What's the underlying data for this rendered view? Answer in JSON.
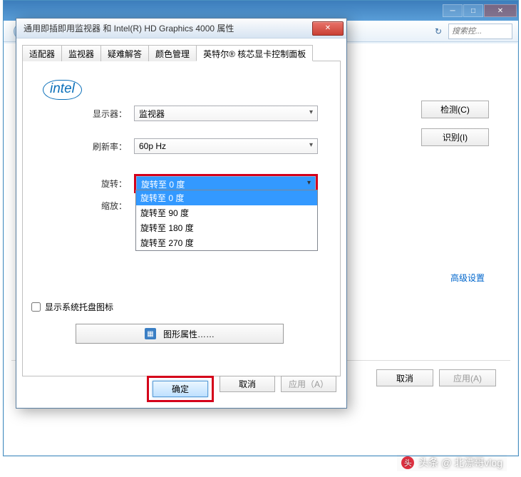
{
  "parent": {
    "search_placeholder": "搜索控...",
    "detect_btn": "检测(C)",
    "identify_btn": "识别(I)",
    "advanced": "高级设置",
    "cancel": "取消",
    "apply": "应用(A)"
  },
  "dialog": {
    "title": "通用即插即用监视器 和 Intel(R) HD Graphics 4000 属性",
    "tabs": {
      "adapter": "适配器",
      "monitor": "监视器",
      "troubleshoot": "疑难解答",
      "color": "颜色管理",
      "intel": "英特尔® 核芯显卡控制面板"
    },
    "logo": "intel",
    "labels": {
      "display": "显示器：",
      "refresh": "刷新率：",
      "rotate": "旋转：",
      "zoom": "缩放："
    },
    "values": {
      "display": "监视器",
      "refresh": "60p Hz",
      "rotate": "旋转至 0 度"
    },
    "rotate_options": [
      "旋转至 0 度",
      "旋转至 90 度",
      "旋转至 180 度",
      "旋转至 270 度"
    ],
    "tray_label": "显示系统托盘图标",
    "gfx_btn": "图形属性……",
    "footer": {
      "ok": "确定",
      "cancel": "取消",
      "apply": "应用（A）"
    }
  },
  "watermark": "头条 @ 北漂哥vlog"
}
